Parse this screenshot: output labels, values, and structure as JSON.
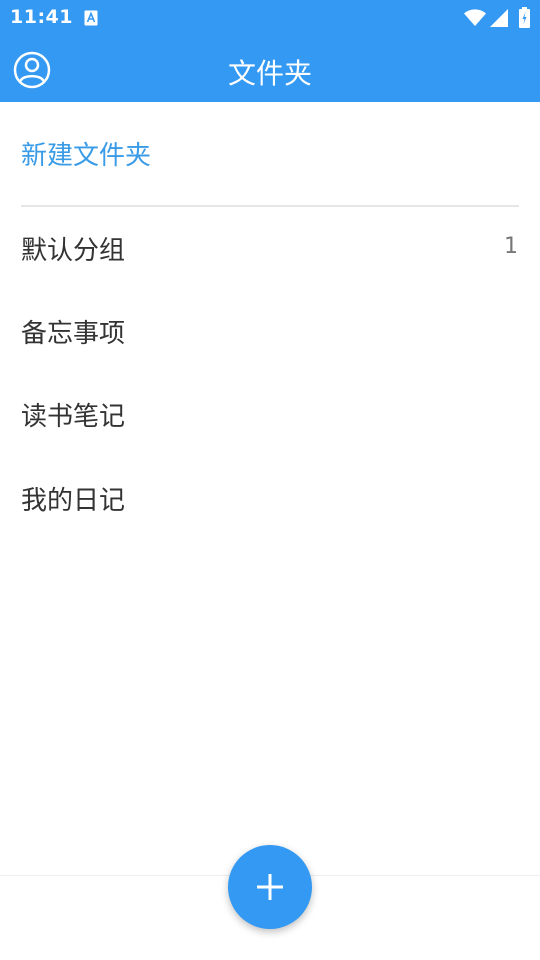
{
  "status": {
    "time": "11:41",
    "icons": [
      "a-notification-icon",
      "wifi-icon",
      "signal-icon",
      "battery-icon"
    ]
  },
  "appbar": {
    "title": "文件夹",
    "profile_icon": "account-circle-icon"
  },
  "new_folder_label": "新建文件夹",
  "folders": [
    {
      "name": "默认分组",
      "count": "1"
    },
    {
      "name": "备忘事项",
      "count": ""
    },
    {
      "name": "读书笔记",
      "count": ""
    },
    {
      "name": "我的日记",
      "count": ""
    }
  ],
  "fab": {
    "icon": "plus-icon"
  },
  "colors": {
    "primary": "#3399f3",
    "link": "#3a9be6",
    "text": "#333333"
  }
}
